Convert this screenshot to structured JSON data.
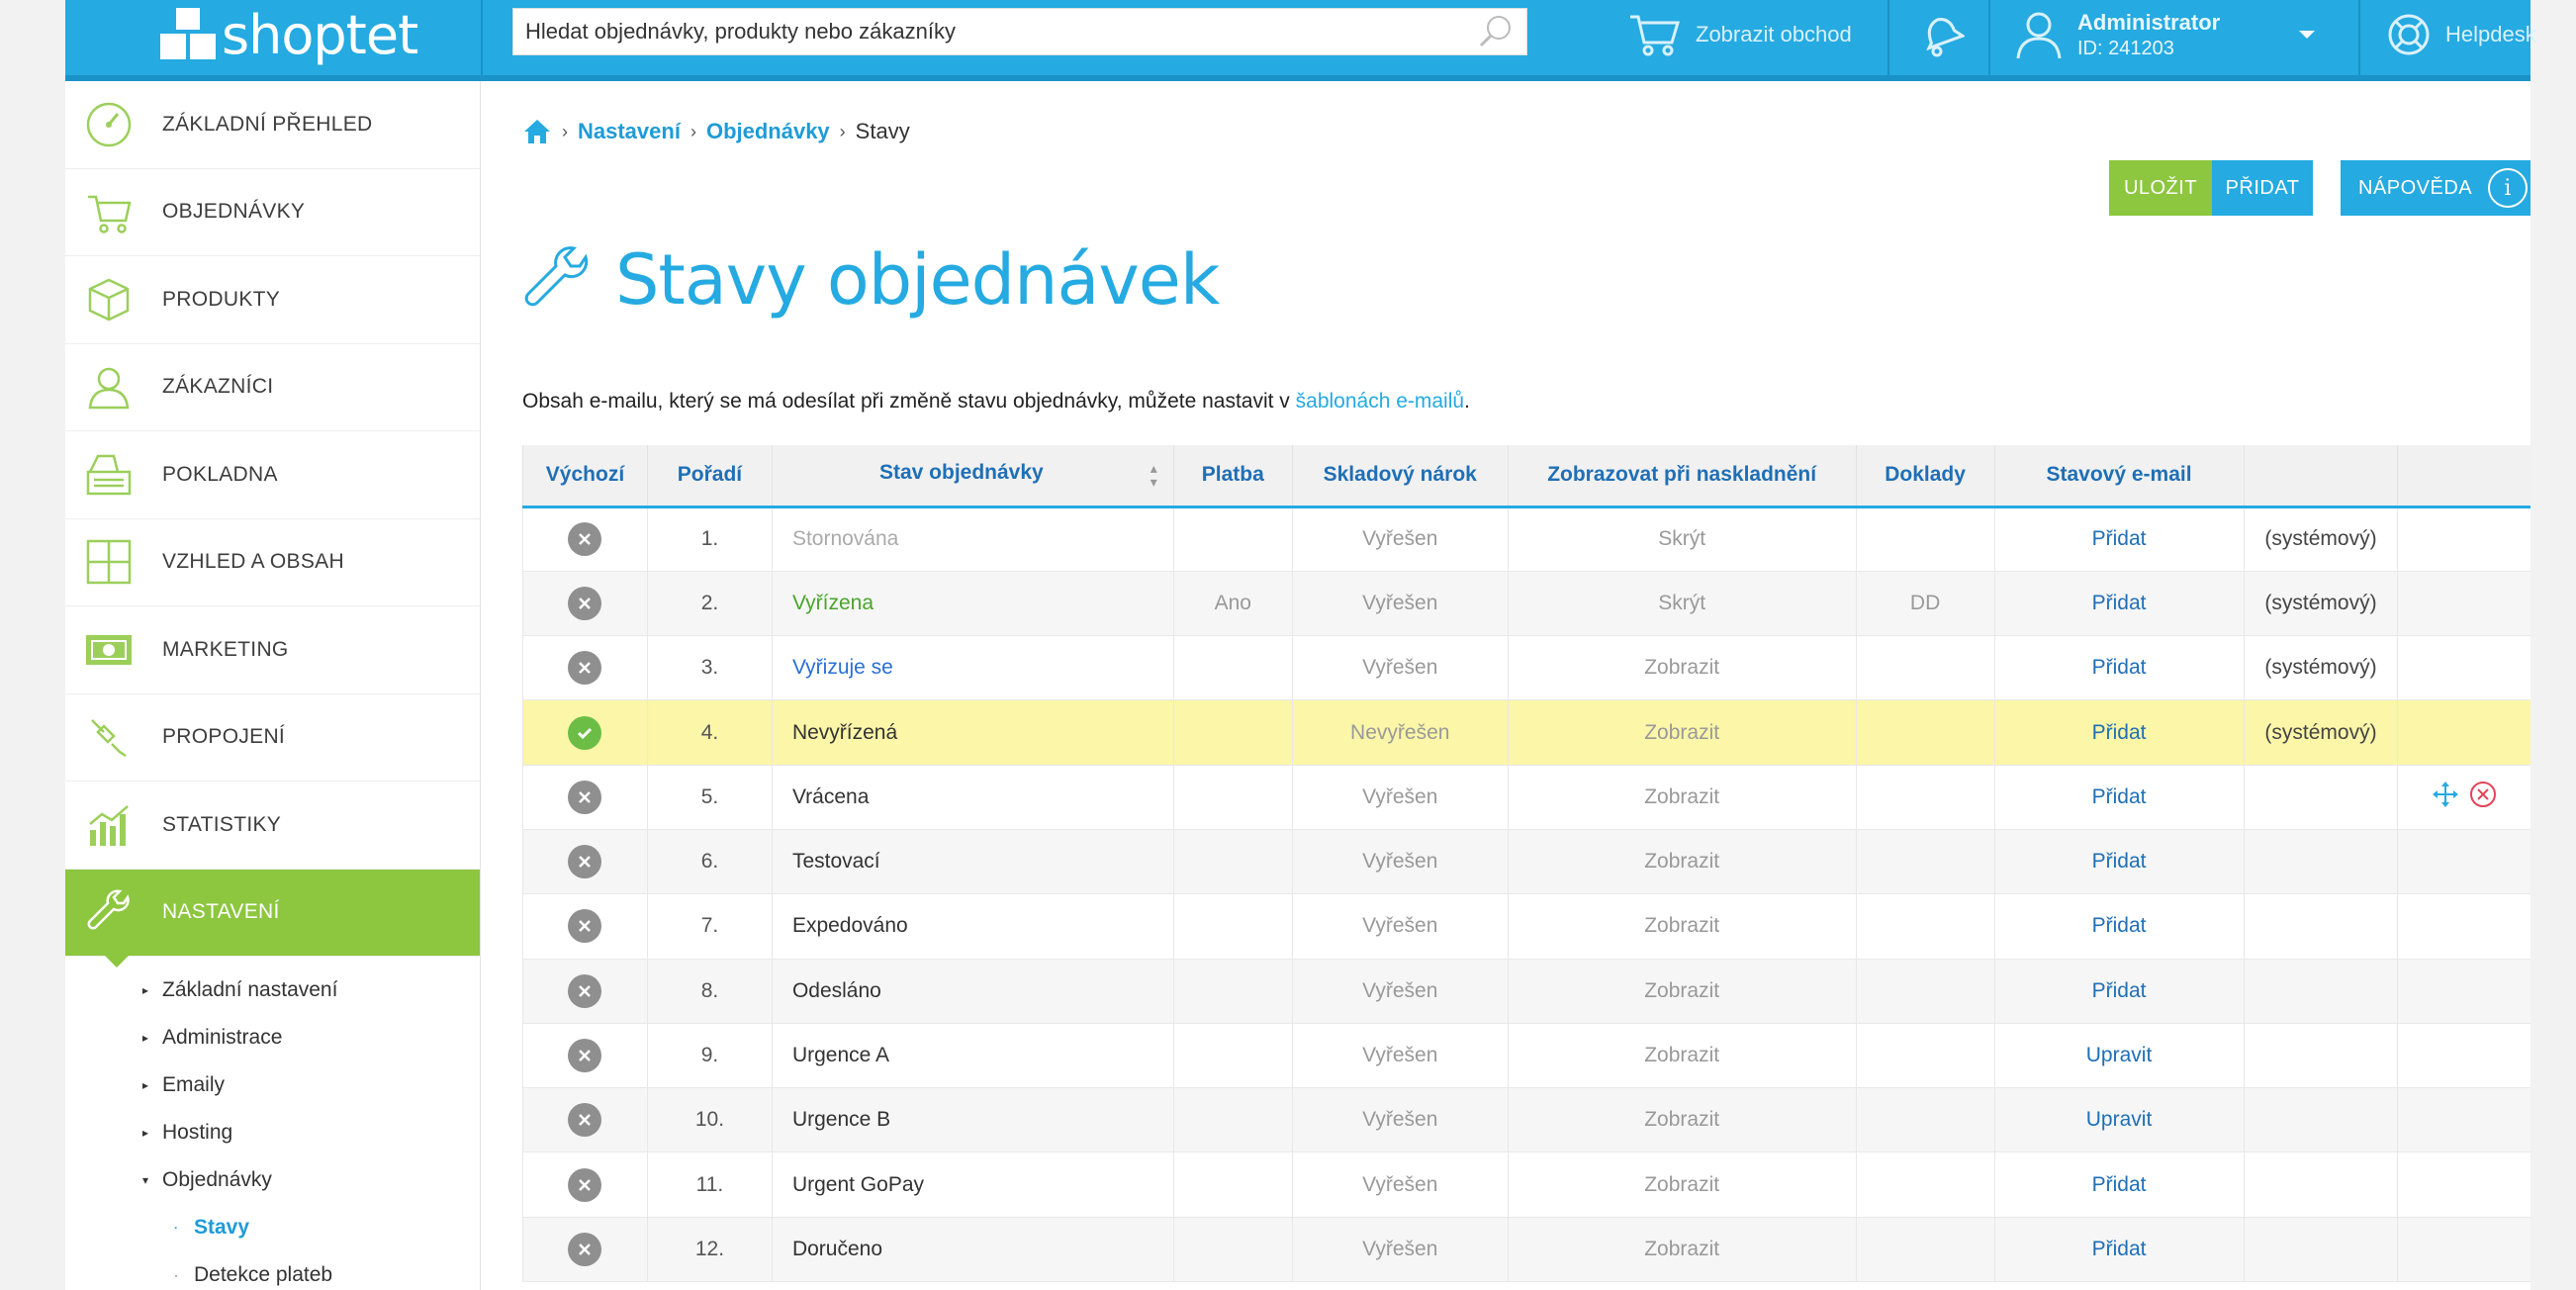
{
  "topbar": {
    "logo_text": "shoptet",
    "search_placeholder": "Hledat objednávky, produkty nebo zákazníky",
    "show_shop": "Zobrazit obchod",
    "admin_name": "Administrator",
    "admin_id": "ID: 241203",
    "helpdesk": "Helpdesk"
  },
  "sidebar": {
    "items": [
      {
        "label": "ZÁKLADNÍ PŘEHLED",
        "icon": "speedometer-icon"
      },
      {
        "label": "OBJEDNÁVKY",
        "icon": "cart-icon"
      },
      {
        "label": "PRODUKTY",
        "icon": "box-icon"
      },
      {
        "label": "ZÁKAZNÍCI",
        "icon": "user-icon"
      },
      {
        "label": "POKLADNA",
        "icon": "cash-register-icon"
      },
      {
        "label": "VZHLED A OBSAH",
        "icon": "layout-icon"
      },
      {
        "label": "MARKETING",
        "icon": "money-icon"
      },
      {
        "label": "PROPOJENÍ",
        "icon": "plug-icon"
      },
      {
        "label": "STATISTIKY",
        "icon": "bar-chart-icon"
      },
      {
        "label": "NASTAVENÍ",
        "icon": "wrench-icon"
      }
    ],
    "sub_items": [
      "Základní nastavení",
      "Administrace",
      "Emaily",
      "Hosting",
      "Objednávky"
    ],
    "sub_sub_items": [
      "Stavy",
      "Detekce plateb"
    ]
  },
  "breadcrumb": {
    "settings": "Nastavení",
    "orders": "Objednávky",
    "current": "Stavy"
  },
  "buttons": {
    "save": "ULOŽIT",
    "add": "PŘIDAT",
    "help": "NÁPOVĚDA"
  },
  "page": {
    "title": "Stavy objednávek",
    "intro_text": "Obsah e-mailu, který se má odesílat při změně stavu objednávky, můžete nastavit v ",
    "intro_link": "šablonách e-mailů",
    "intro_end": "."
  },
  "table": {
    "headers": [
      "Výchozí",
      "Pořadí",
      "Stav objednávky",
      "Platba",
      "Skladový nárok",
      "Zobrazovat při naskladnění",
      "Doklady",
      "Stavový e-mail",
      "",
      ""
    ],
    "rows": [
      {
        "default": false,
        "order": "1.",
        "name": "Stornována",
        "payment": "",
        "stock": "Vyřešen",
        "show": "Skrýt",
        "docs": "",
        "email": "Přidat",
        "system": "(systémový)",
        "color": "grey"
      },
      {
        "default": false,
        "order": "2.",
        "name": "Vyřízena",
        "payment": "Ano",
        "stock": "Vyřešen",
        "show": "Skrýt",
        "docs": "DD",
        "email": "Přidat",
        "system": "(systémový)",
        "color": "green"
      },
      {
        "default": false,
        "order": "3.",
        "name": "Vyřizuje se",
        "payment": "",
        "stock": "Vyřešen",
        "show": "Zobrazit",
        "docs": "",
        "email": "Přidat",
        "system": "(systémový)",
        "color": "blue"
      },
      {
        "default": true,
        "order": "4.",
        "name": "Nevyřízená",
        "payment": "",
        "stock": "Nevyřešen",
        "show": "Zobrazit",
        "docs": "",
        "email": "Přidat",
        "system": "(systémový)",
        "color": "dark"
      },
      {
        "default": false,
        "order": "5.",
        "name": "Vrácena",
        "payment": "",
        "stock": "Vyřešen",
        "show": "Zobrazit",
        "docs": "",
        "email": "Přidat",
        "system": "",
        "color": "dark"
      },
      {
        "default": false,
        "order": "6.",
        "name": "Testovací",
        "payment": "",
        "stock": "Vyřešen",
        "show": "Zobrazit",
        "docs": "",
        "email": "Přidat",
        "system": "",
        "color": "dark"
      },
      {
        "default": false,
        "order": "7.",
        "name": "Expedováno",
        "payment": "",
        "stock": "Vyřešen",
        "show": "Zobrazit",
        "docs": "",
        "email": "Přidat",
        "system": "",
        "color": "dark"
      },
      {
        "default": false,
        "order": "8.",
        "name": "Odesláno",
        "payment": "",
        "stock": "Vyřešen",
        "show": "Zobrazit",
        "docs": "",
        "email": "Přidat",
        "system": "",
        "color": "dark"
      },
      {
        "default": false,
        "order": "9.",
        "name": "Urgence A",
        "payment": "",
        "stock": "Vyřešen",
        "show": "Zobrazit",
        "docs": "",
        "email": "Upravit",
        "system": "",
        "color": "dark"
      },
      {
        "default": false,
        "order": "10.",
        "name": "Urgence B",
        "payment": "",
        "stock": "Vyřešen",
        "show": "Zobrazit",
        "docs": "",
        "email": "Upravit",
        "system": "",
        "color": "dark"
      },
      {
        "default": false,
        "order": "11.",
        "name": "Urgent GoPay",
        "payment": "",
        "stock": "Vyřešen",
        "show": "Zobrazit",
        "docs": "",
        "email": "Přidat",
        "system": "",
        "color": "dark"
      },
      {
        "default": false,
        "order": "12.",
        "name": "Doručeno",
        "payment": "",
        "stock": "Vyřešen",
        "show": "Zobrazit",
        "docs": "",
        "email": "Přidat",
        "system": "",
        "color": "dark"
      }
    ]
  },
  "colors": {
    "brand_blue": "#25aae1",
    "brand_green": "#8dc63f",
    "highlight_row": "#fbf6a8"
  }
}
